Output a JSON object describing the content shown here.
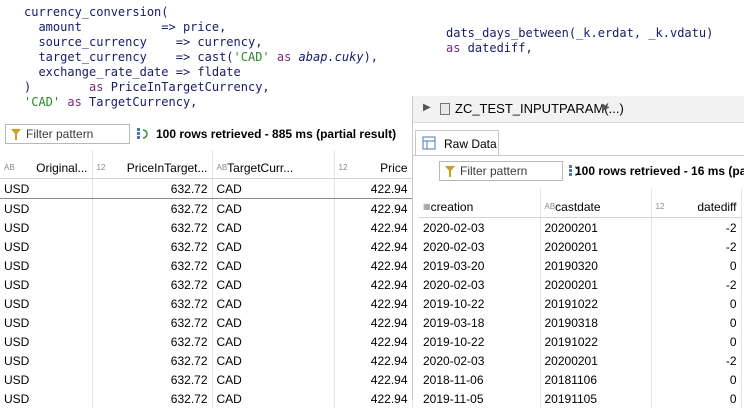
{
  "code_left": {
    "lines": [
      [
        [
          "currency_conversion(",
          ""
        ]
      ],
      [
        [
          "  amount           => price,",
          ""
        ]
      ],
      [
        [
          "  source_currency    => currency,",
          ""
        ]
      ],
      [
        [
          "  target_currency    => ",
          ""
        ],
        [
          "cast(",
          ""
        ],
        [
          "'CAD'",
          "str"
        ],
        [
          " as ",
          "kw"
        ],
        [
          "abap.cuky",
          "it"
        ],
        [
          "),",
          ""
        ]
      ],
      [
        [
          "  exchange_rate_date => fldate",
          ""
        ]
      ],
      [
        [
          ")        ",
          ""
        ],
        [
          "as",
          "kw"
        ],
        [
          " PriceInTargetCurrency,",
          ""
        ]
      ],
      [
        [
          "'CAD'",
          "str"
        ],
        [
          " as",
          "kw"
        ],
        [
          " TargetCurrency,",
          ""
        ]
      ]
    ]
  },
  "code_right": {
    "lines": [
      [
        [
          "dats_days_between(_k.erdat, _k.vdatu)",
          ""
        ]
      ],
      [
        [
          "as",
          "kw"
        ],
        [
          " datediff,",
          ""
        ]
      ]
    ]
  },
  "left_result": {
    "filter_placeholder": "Filter pattern",
    "status": "100 rows retrieved - 885 ms (partial result)",
    "columns": [
      {
        "label": "Original...",
        "type_icon": "AB"
      },
      {
        "label": "PriceInTarget...",
        "type_icon": "12"
      },
      {
        "label": "TargetCurr...",
        "type_icon": "AB"
      },
      {
        "label": "Price",
        "type_icon": "12"
      }
    ],
    "rows": [
      [
        "USD",
        "632.72",
        "CAD",
        "422.94"
      ],
      [
        "USD",
        "632.72",
        "CAD",
        "422.94"
      ],
      [
        "USD",
        "632.72",
        "CAD",
        "422.94"
      ],
      [
        "USD",
        "632.72",
        "CAD",
        "422.94"
      ],
      [
        "USD",
        "632.72",
        "CAD",
        "422.94"
      ],
      [
        "USD",
        "632.72",
        "CAD",
        "422.94"
      ],
      [
        "USD",
        "632.72",
        "CAD",
        "422.94"
      ],
      [
        "USD",
        "632.72",
        "CAD",
        "422.94"
      ],
      [
        "USD",
        "632.72",
        "CAD",
        "422.94"
      ],
      [
        "USD",
        "632.72",
        "CAD",
        "422.94"
      ],
      [
        "USD",
        "632.72",
        "CAD",
        "422.94"
      ],
      [
        "USD",
        "632.72",
        "CAD",
        "422.94"
      ]
    ]
  },
  "right_panel": {
    "breadcrumb": "ZC_TEST_INPUTPARAM(...)",
    "tab_label": "Raw Data",
    "filter_placeholder": "Filter pattern",
    "status": "100 rows retrieved - 16 ms (pa",
    "columns": [
      {
        "label": "creation",
        "type_icon": "▦"
      },
      {
        "label": "castdate",
        "type_icon": "AB"
      },
      {
        "label": "datediff",
        "type_icon": "12"
      }
    ],
    "rows": [
      [
        "2020-02-03",
        "20200201",
        "-2"
      ],
      [
        "2020-02-03",
        "20200201",
        "-2"
      ],
      [
        "2019-03-20",
        "20190320",
        "0"
      ],
      [
        "2020-02-03",
        "20200201",
        "-2"
      ],
      [
        "2019-10-22",
        "20191022",
        "0"
      ],
      [
        "2019-03-18",
        "20190318",
        "0"
      ],
      [
        "2019-10-22",
        "20191022",
        "0"
      ],
      [
        "2020-02-03",
        "20200201",
        "-2"
      ],
      [
        "2018-11-06",
        "20181106",
        "0"
      ],
      [
        "2019-11-05",
        "20191105",
        "0"
      ]
    ]
  }
}
